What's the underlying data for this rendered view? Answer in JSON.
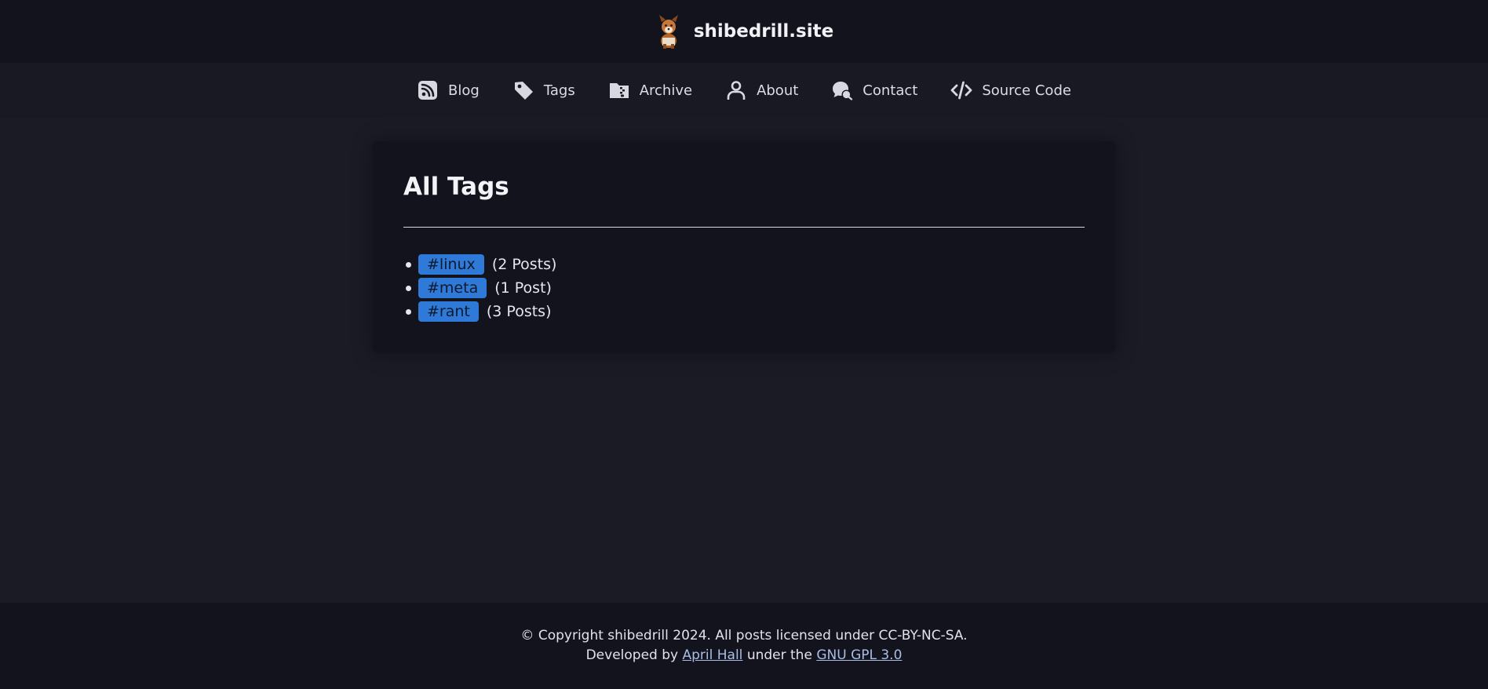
{
  "header": {
    "site_name": "shibedrill.site",
    "logo_icon": "shiba-dog-logo"
  },
  "nav": {
    "items": [
      {
        "label": "Blog",
        "icon": "rss-icon"
      },
      {
        "label": "Tags",
        "icon": "tag-icon"
      },
      {
        "label": "Archive",
        "icon": "archive-file-icon"
      },
      {
        "label": "About",
        "icon": "user-icon"
      },
      {
        "label": "Contact",
        "icon": "chat-icon"
      },
      {
        "label": "Source Code",
        "icon": "code-icon"
      }
    ]
  },
  "main": {
    "title": "All Tags",
    "tags": [
      {
        "name": "#linux",
        "count": "(2 Posts)"
      },
      {
        "name": "#meta",
        "count": "(1 Post)"
      },
      {
        "name": "#rant",
        "count": "(3 Posts)"
      }
    ]
  },
  "footer": {
    "copyright": "© Copyright shibedrill 2024. All posts licensed under CC-BY-NC-SA.",
    "developed_prefix": "Developed by",
    "developer_link": "April Hall",
    "license_prefix": "under the",
    "license_link": "GNU GPL 3.0"
  },
  "colors": {
    "background": "#1b1b26",
    "header": "#12131d",
    "card": "#12131c",
    "tag_accent": "#2f7ad8",
    "link": "#a9bde6"
  }
}
